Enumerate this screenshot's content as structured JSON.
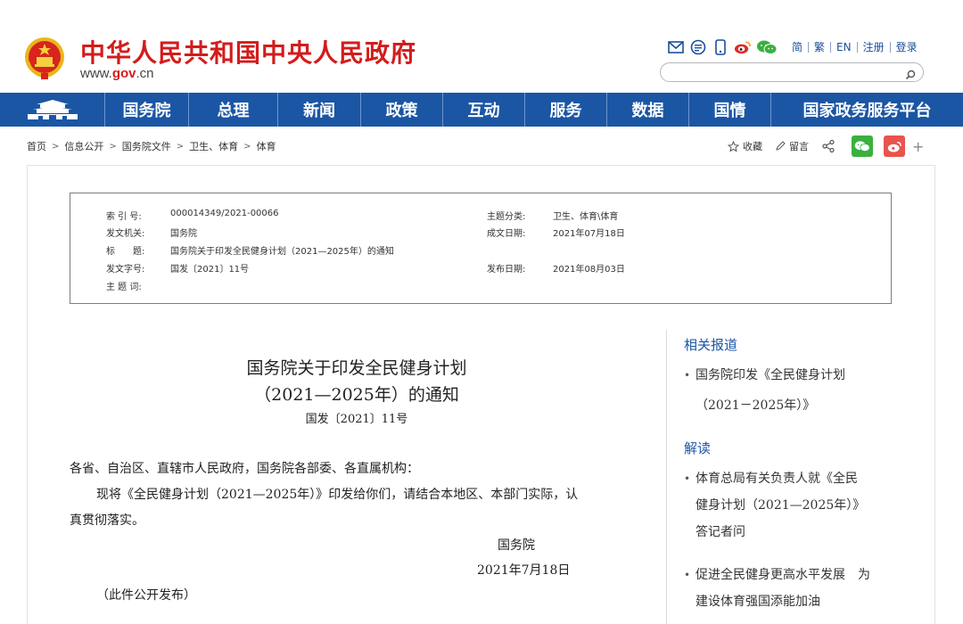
{
  "header": {
    "site_title": "中华人民共和国中央人民政府",
    "url_prefix": "www.",
    "url_brand": "gov",
    "url_suffix": ".cn",
    "top_links": [
      "简",
      "繁",
      "EN",
      "注册",
      "登录"
    ],
    "search_placeholder": ""
  },
  "nav": {
    "items": [
      "国务院",
      "总理",
      "新闻",
      "政策",
      "互动",
      "服务",
      "数据",
      "国情",
      "国家政务服务平台"
    ]
  },
  "breadcrumb": [
    "首页",
    "信息公开",
    "国务院文件",
    "卫生、体育",
    "体育"
  ],
  "tools": {
    "favorite": "收藏",
    "comment": "留言"
  },
  "meta": {
    "index_label": "索 引 号:",
    "index_value": "000014349/2021-00066",
    "topic_label": "主题分类:",
    "topic_value": "卫生、体育\\体育",
    "issuer_label": "发文机关:",
    "issuer_value": "国务院",
    "written_label": "成文日期:",
    "written_value": "2021年07月18日",
    "title_label": "标　　题:",
    "title_value": "国务院关于印发全民健身计划（2021—2025年）的通知",
    "docno_label": "发文字号:",
    "docno_value": "国发〔2021〕11号",
    "published_label": "发布日期:",
    "published_value": "2021年08月03日",
    "keyword_label": "主 题 词:",
    "keyword_value": ""
  },
  "article": {
    "title_line1": "国务院关于印发全民健身计划",
    "title_line2": "（2021—2025年）的通知",
    "doc_number": "国发〔2021〕11号",
    "salutation": "各省、自治区、直辖市人民政府，国务院各部委、各直属机构：",
    "body_line1": "现将《全民健身计划（2021—2025年）》印发给你们，请结合本地区、本部门实际，认",
    "body_line2": "真贯彻落实。",
    "signature": "国务院",
    "date": "2021年7月18日",
    "note": "（此件公开发布）"
  },
  "sidebar": {
    "related_heading": "相关报道",
    "related_items": [
      {
        "line1": "国务院印发《全民健身计划",
        "line2": "（2021－2025年）》"
      }
    ],
    "interpret_heading": "解读",
    "interpret_items": [
      {
        "line1": "体育总局有关负责人就《全民",
        "line2": "健身计划（2021—2025年）》",
        "line3": "答记者问"
      },
      {
        "line1": "促进全民健身更高水平发展　为",
        "line2": "建设体育强国添能加油"
      }
    ]
  },
  "colors": {
    "brand_red": "#d31c1c",
    "nav_blue": "#1b56a4",
    "link_blue": "#1a4f9c"
  }
}
